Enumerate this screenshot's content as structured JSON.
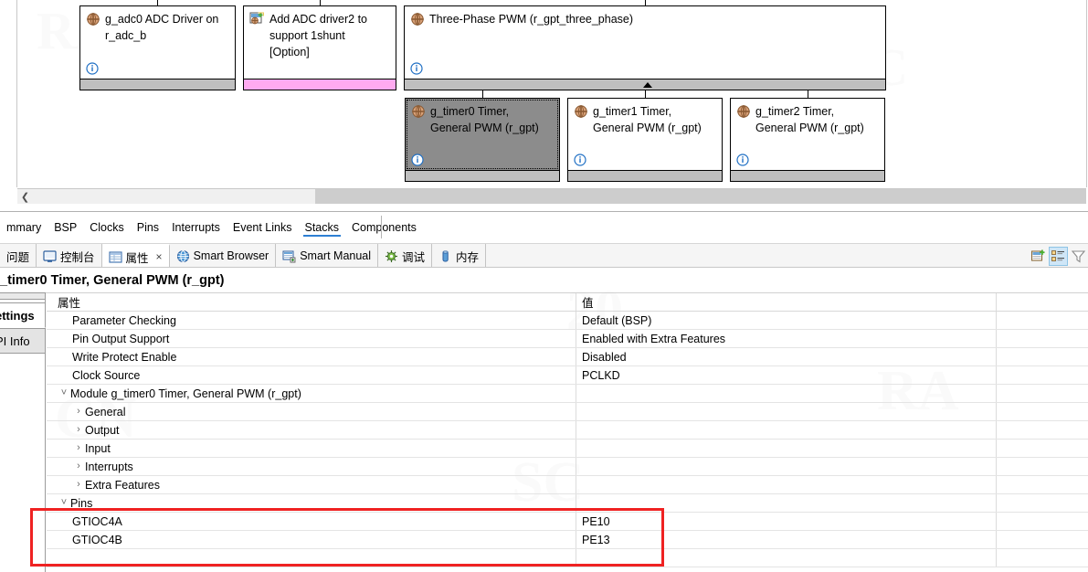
{
  "colors": {
    "selected_box_bg": "#8c8c8c",
    "footer_gray": "#bfbfbf",
    "footer_pink": "#ffaaf0",
    "tab_accent": "#2d7fd3",
    "annotation_red": "#ef2222",
    "toolbar_active": "#cfe6f7"
  },
  "stacks_diagram": {
    "boxes": [
      {
        "id": "adc0",
        "title": "g_adc0 ADC Driver on\nr_adc_b",
        "icon": "module-icon",
        "info_icon": "info-icon",
        "footer": "gray",
        "selected": false
      },
      {
        "id": "adc2",
        "title": "Add ADC driver2 to\nsupport 1shunt\n[Option]",
        "icon": "add-module-icon",
        "info_icon": null,
        "footer": "pink",
        "selected": false
      },
      {
        "id": "three_phase",
        "title": "Three-Phase PWM (r_gpt_three_phase)",
        "icon": "module-icon",
        "info_icon": "info-icon",
        "footer": "gray",
        "selected": false
      },
      {
        "id": "timer0",
        "title": "g_timer0 Timer,\nGeneral PWM (r_gpt)",
        "icon": "module-icon",
        "info_icon": "info-icon",
        "footer": "gray",
        "selected": true
      },
      {
        "id": "timer1",
        "title": "g_timer1 Timer,\nGeneral PWM (r_gpt)",
        "icon": "module-icon",
        "info_icon": "info-icon",
        "footer": "gray",
        "selected": false
      },
      {
        "id": "timer2",
        "title": "g_timer2 Timer,\nGeneral PWM (r_gpt)",
        "icon": "module-icon",
        "info_icon": "info-icon",
        "footer": "gray",
        "selected": false
      }
    ],
    "scrollbar": {
      "left_arrow_icon": "chevron-left-icon"
    }
  },
  "config_tabs": {
    "items": [
      {
        "label": "mmary",
        "active": false
      },
      {
        "label": "BSP",
        "active": false
      },
      {
        "label": "Clocks",
        "active": false
      },
      {
        "label": "Pins",
        "active": false
      },
      {
        "label": "Interrupts",
        "active": false
      },
      {
        "label": "Event Links",
        "active": false
      },
      {
        "label": "Stacks",
        "active": true
      },
      {
        "label": "Components",
        "active": false
      }
    ]
  },
  "view_tabs": {
    "items": [
      {
        "label": "问题",
        "icon": null,
        "active": false,
        "closable": false
      },
      {
        "label": "控制台",
        "icon": "console-icon",
        "active": false,
        "closable": false
      },
      {
        "label": "属性",
        "icon": "properties-icon",
        "active": true,
        "closable": true,
        "close_label": "×"
      },
      {
        "label": "Smart Browser",
        "icon": "globe-icon",
        "active": false,
        "closable": false
      },
      {
        "label": "Smart Manual",
        "icon": "manual-icon",
        "active": false,
        "closable": false
      },
      {
        "label": "调试",
        "icon": "debug-icon",
        "active": false,
        "closable": false
      },
      {
        "label": "内存",
        "icon": "memory-icon",
        "active": false,
        "closable": false
      }
    ],
    "toolbar": [
      {
        "name": "new-property-view-icon",
        "active": false
      },
      {
        "name": "show-categories-icon",
        "active": true
      },
      {
        "name": "filter-icon",
        "active": false
      }
    ]
  },
  "properties": {
    "title": "_timer0 Timer, General PWM (r_gpt)",
    "rail_tabs": [
      {
        "label": "ettings",
        "active": true
      },
      {
        "label": "PI Info",
        "active": false
      }
    ],
    "columns": {
      "name": "属性",
      "value": "值"
    },
    "rows": [
      {
        "indent": 2,
        "twisty": "",
        "name": "Parameter Checking",
        "value": "Default (BSP)"
      },
      {
        "indent": 2,
        "twisty": "",
        "name": "Pin Output Support",
        "value": "Enabled with Extra Features"
      },
      {
        "indent": 2,
        "twisty": "",
        "name": "Write Protect Enable",
        "value": "Disabled"
      },
      {
        "indent": 2,
        "twisty": "",
        "name": "Clock Source",
        "value": "PCLKD"
      },
      {
        "indent": 1,
        "twisty": "expanded",
        "name": "Module g_timer0 Timer, General PWM (r_gpt)",
        "value": ""
      },
      {
        "indent": 2,
        "twisty": "collapsed",
        "name": "General",
        "value": ""
      },
      {
        "indent": 2,
        "twisty": "collapsed",
        "name": "Output",
        "value": ""
      },
      {
        "indent": 2,
        "twisty": "collapsed",
        "name": "Input",
        "value": ""
      },
      {
        "indent": 2,
        "twisty": "collapsed",
        "name": "Interrupts",
        "value": ""
      },
      {
        "indent": 2,
        "twisty": "collapsed",
        "name": "Extra Features",
        "value": ""
      },
      {
        "indent": 2,
        "twisty": "expanded",
        "name": "Pins",
        "value": "",
        "highlighted": true
      },
      {
        "indent": 3,
        "twisty": "",
        "name": "GTIOC4A",
        "value": "PE10",
        "highlighted": true
      },
      {
        "indent": 3,
        "twisty": "",
        "name": "GTIOC4B",
        "value": "PE13",
        "highlighted": true
      },
      {
        "indent": 3,
        "twisty": "",
        "name": "",
        "value": "",
        "highlighted": true
      }
    ]
  }
}
